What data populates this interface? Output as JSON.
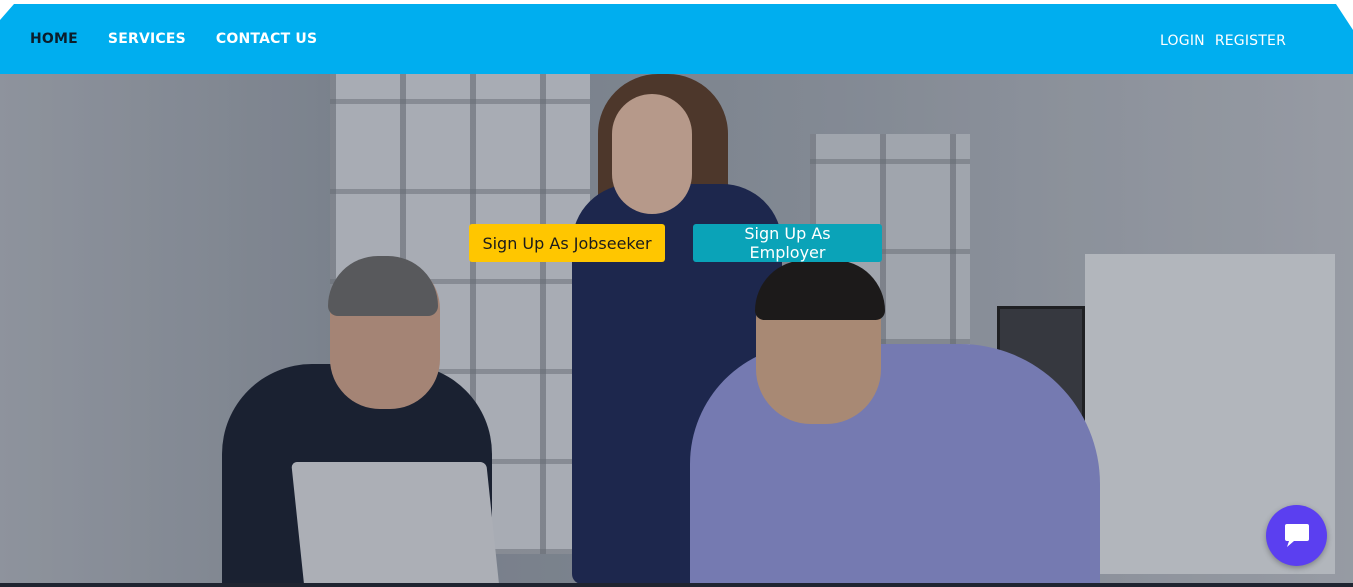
{
  "nav": {
    "home": "HOME",
    "services": "SERVICES",
    "contact": "CONTACT US",
    "login": "LOGIN",
    "register": "REGISTER"
  },
  "hero": {
    "jobseeker_button": "Sign Up As Jobseeker",
    "employer_button": "Sign Up As Employer"
  },
  "chat": {
    "icon": "chat-bubble-icon"
  },
  "colors": {
    "navbar": "#00aeef",
    "jobseeker": "#ffc600",
    "employer": "#0aa3b8",
    "chat": "#5b3ff0"
  }
}
